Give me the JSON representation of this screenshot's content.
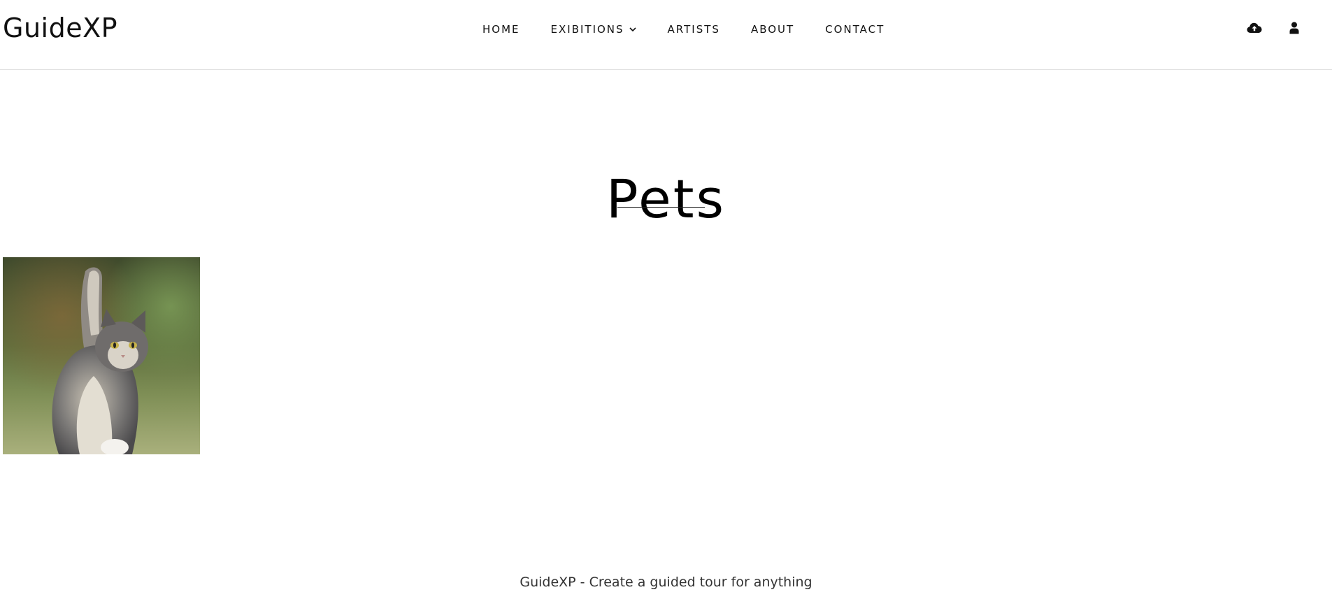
{
  "header": {
    "logo": "GuideXP",
    "nav": [
      {
        "label": "HOME"
      },
      {
        "label": "EXIBITIONS",
        "has_dropdown": true
      },
      {
        "label": "ARTISTS"
      },
      {
        "label": "ABOUT"
      },
      {
        "label": "CONTACT"
      }
    ],
    "icons": [
      "cloud-upload-icon",
      "user-icon"
    ]
  },
  "main": {
    "title": "Pets",
    "gallery": [
      {
        "subject": "kitten-raising-paw-photo"
      }
    ]
  },
  "footer": {
    "text": "GuideXP - Create a guided tour for anything"
  }
}
